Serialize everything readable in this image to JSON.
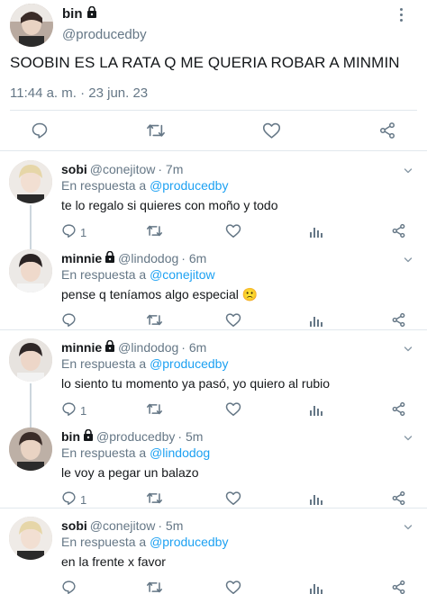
{
  "main_tweet": {
    "name": "bin",
    "handle": "@producedby",
    "text": "SOOBIN ES LA RATA Q ME QUERIA ROBAR A MINMIN",
    "time": "11:44 a. m. · 23 jun. 23"
  },
  "replies": [
    {
      "name": "sobi",
      "handle": "@conejitow",
      "time": "· 7m",
      "reply_prefix": "En respuesta a ",
      "reply_to": "@producedby",
      "text": "te lo regalo si quieres con moño y todo",
      "reply_count": "1",
      "locked": false
    },
    {
      "name": "minnie",
      "handle": "@lindodog",
      "time": "· 6m",
      "reply_prefix": "En respuesta a ",
      "reply_to": "@conejitow",
      "text": "pense q teníamos algo especial 🙁",
      "reply_count": "",
      "locked": true
    },
    {
      "name": "minnie",
      "handle": "@lindodog",
      "time": "· 6m",
      "reply_prefix": "En respuesta a ",
      "reply_to": "@producedby",
      "text": "lo siento tu momento ya pasó, yo quiero al rubio",
      "reply_count": "1",
      "locked": true
    },
    {
      "name": "bin",
      "handle": "@producedby",
      "time": "· 5m",
      "reply_prefix": "En respuesta a ",
      "reply_to": "@lindodog",
      "text": "le voy a pegar un balazo",
      "reply_count": "1",
      "locked": true
    },
    {
      "name": "sobi",
      "handle": "@conejitow",
      "time": "· 5m",
      "reply_prefix": "En respuesta a ",
      "reply_to": "@producedby",
      "text": "en la frente x favor",
      "reply_count": "",
      "locked": false
    }
  ],
  "colors": {
    "text": "#14171a",
    "secondary": "#657786",
    "link": "#1da1f2",
    "separator": "#e1e8ed"
  },
  "icons": [
    "lock-icon",
    "more-icon",
    "reply-icon",
    "retweet-icon",
    "like-icon",
    "analytics-icon",
    "share-icon"
  ]
}
